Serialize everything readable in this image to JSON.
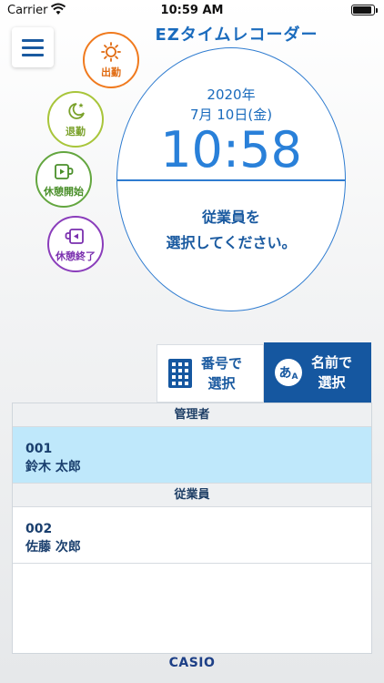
{
  "status_bar": {
    "carrier": "Carrier",
    "time": "10:59 AM"
  },
  "header": {
    "title": "EZタイムレコーダー"
  },
  "actions": {
    "clock_in": "出勤",
    "clock_out": "退勤",
    "break_start": "休憩開始",
    "break_end": "休憩終了"
  },
  "clock": {
    "date_line1": "2020年",
    "date_line2": "7月 10日(金)",
    "time": "10:58",
    "message_line1": "従業員を",
    "message_line2": "選択してください。"
  },
  "select_tabs": {
    "by_number_line1": "番号で",
    "by_number_line2": "選択",
    "by_name_line1": "名前で",
    "by_name_line2": "選択",
    "name_icon_text": "あ",
    "name_icon_sub": "A"
  },
  "employee_list": {
    "sections": [
      {
        "title": "管理者",
        "rows": [
          {
            "id": "001",
            "name": "鈴木 太郎",
            "selected": true
          }
        ]
      },
      {
        "title": "従業員",
        "rows": [
          {
            "id": "002",
            "name": "佐藤 次郎",
            "selected": false
          }
        ]
      }
    ]
  },
  "footer": {
    "brand": "CASIO"
  },
  "colors": {
    "primary": "#1557a0",
    "clock_in": "#f07a1e",
    "clock_out": "#a8c53a",
    "break_start": "#63a63f",
    "break_end": "#8a3dbb",
    "selected_row": "#bfe8fb"
  }
}
